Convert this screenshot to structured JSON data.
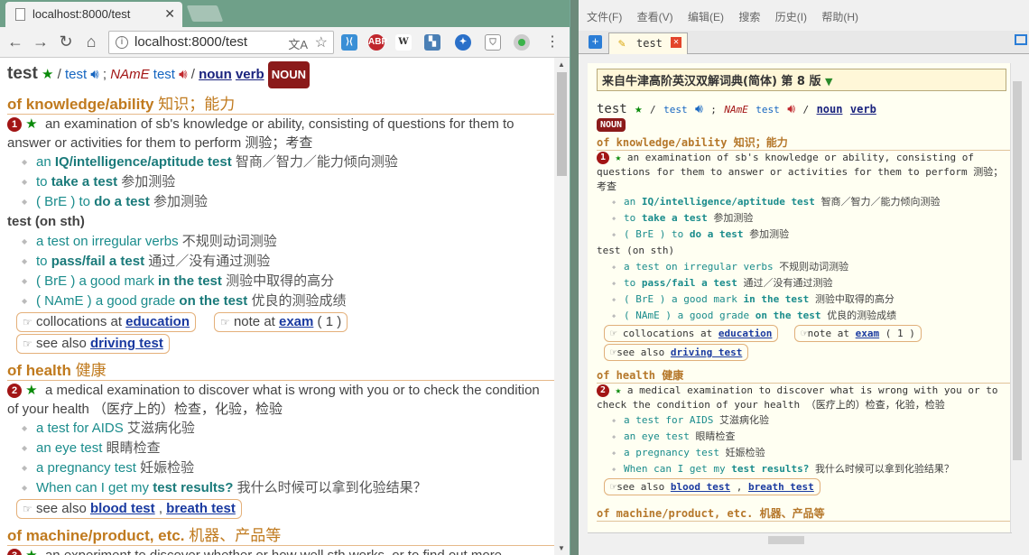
{
  "browser": {
    "tab_title": "localhost:8000/test",
    "url": "localhost:8000/test",
    "extensions": [
      "translate-icon",
      "puzzle-icon",
      "adblock-icon",
      "w-icon",
      "ext-icon",
      "network-icon",
      "shield-icon",
      "green-dot-icon"
    ]
  },
  "entry": {
    "headword": "test",
    "sep1": "/",
    "pron_br": "test",
    "semicolon": ";",
    "name_label": "NAmE",
    "pron_am": "test",
    "sep2": "/",
    "pos1": "noun",
    "pos2": "verb",
    "badge": "NOUN"
  },
  "senses": [
    {
      "heading": "of knowledge/ability",
      "heading_cn": "知识；能力",
      "num": "1",
      "definition": "an examination of sb's knowledge or ability, consisting of questions for them to answer or activities for them to perform 测验；考查",
      "examples1": [
        {
          "pre": "an ",
          "bold": "IQ/intelligence/aptitude test",
          "post": "",
          "cn": "智商／智力／能力倾向测验"
        },
        {
          "pre": "to ",
          "bold": "take a test",
          "post": "",
          "cn": "参加测验"
        },
        {
          "pre": "( BrE ) to ",
          "bold": "do a test",
          "post": "",
          "cn": "参加测验"
        }
      ],
      "grammar": "test (on sth)",
      "examples2": [
        {
          "pre": "a test on irregular verbs ",
          "bold": "",
          "post": "",
          "cn": "不规则动词测验"
        },
        {
          "pre": "to ",
          "bold": "pass/fail a test",
          "post": "",
          "cn": "通过／没有通过测验"
        },
        {
          "pre": "( BrE ) a good mark ",
          "bold": "in the test",
          "post": "",
          "cn": "测验中取得的高分"
        },
        {
          "pre": "( NAmE ) a good grade ",
          "bold": "on the test",
          "post": "",
          "cn": "优良的测验成绩"
        }
      ],
      "xref1_label": "collocations at",
      "xref1_link": "education",
      "xref2_label": "note at",
      "xref2_link": "exam",
      "xref2_num": "( 1 )",
      "xref3_label": "see also",
      "xref3_link": "driving test"
    },
    {
      "heading": "of health",
      "heading_cn": "健康",
      "num": "2",
      "definition": "a medical examination to discover what is wrong with you or to check the condition of your health （医疗上的）检查，化验，检验",
      "examples1": [
        {
          "pre": "a test for AIDS ",
          "bold": "",
          "post": "",
          "cn": "艾滋病化验"
        },
        {
          "pre": "an eye test ",
          "bold": "",
          "post": "",
          "cn": "眼睛检查"
        },
        {
          "pre": "a pregnancy test ",
          "bold": "",
          "post": "",
          "cn": "妊娠检验"
        },
        {
          "pre": "When can I get my ",
          "bold": "test results?",
          "post": "",
          "cn": "我什么时候可以拿到化验结果？"
        }
      ],
      "xref3_label": "see also",
      "xref3_link": "blood test",
      "xref3_link2": "breath test",
      "comma": ","
    },
    {
      "heading": "of machine/product, etc.",
      "heading_cn": "机器、产品等",
      "num": "3",
      "definition": "an experiment to discover whether or how well sth works, or to find out more"
    }
  ],
  "right": {
    "menu": [
      "文件(F)",
      "查看(V)",
      "编辑(E)",
      "搜索",
      "历史(I)",
      "帮助(H)"
    ],
    "tab_title": "test",
    "dict_title": "来自牛津高阶英汉双解词典(简体) 第 8 版"
  }
}
